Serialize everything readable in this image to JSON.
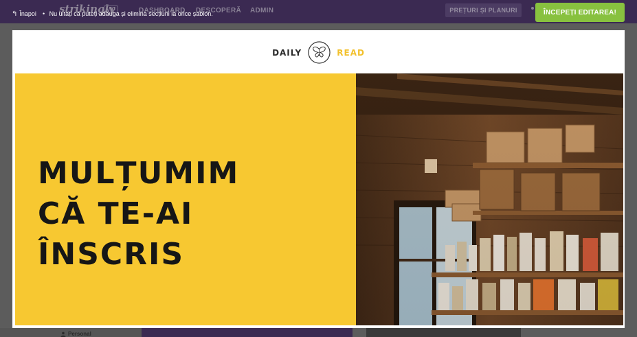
{
  "topbar": {
    "logo": "strikingly",
    "vip_badge": "VIP",
    "nav": [
      "DASHBOARD",
      "DESCOPERĂ",
      "ADMIN"
    ],
    "pricing_label": "PREȚURI ȘI PLANURI",
    "back_label": "Înapoi",
    "tip_separator": "•",
    "tip_text": "Nu uitați că puteți adăuga și elimina secțiuni la orice șablon.",
    "start_editing_label": "ÎNCEPEȚI EDITAREA!"
  },
  "bottom": {
    "personal_label": "Personal"
  },
  "preview": {
    "brand": {
      "left": "DAILY",
      "right": "READ"
    },
    "hero": {
      "title_lines": [
        "MULȚUMIM",
        "CĂ TE-AI",
        "ÎNSCRIS"
      ]
    }
  },
  "colors": {
    "topbar": "#3b2a52",
    "accent_green": "#88c13f",
    "hero_yellow": "#f7c831",
    "brand_read": "#f2c12e"
  },
  "icons": {
    "back": "reply-arrow-icon",
    "brand": "butterfly-icon",
    "personal": "user-icon"
  }
}
